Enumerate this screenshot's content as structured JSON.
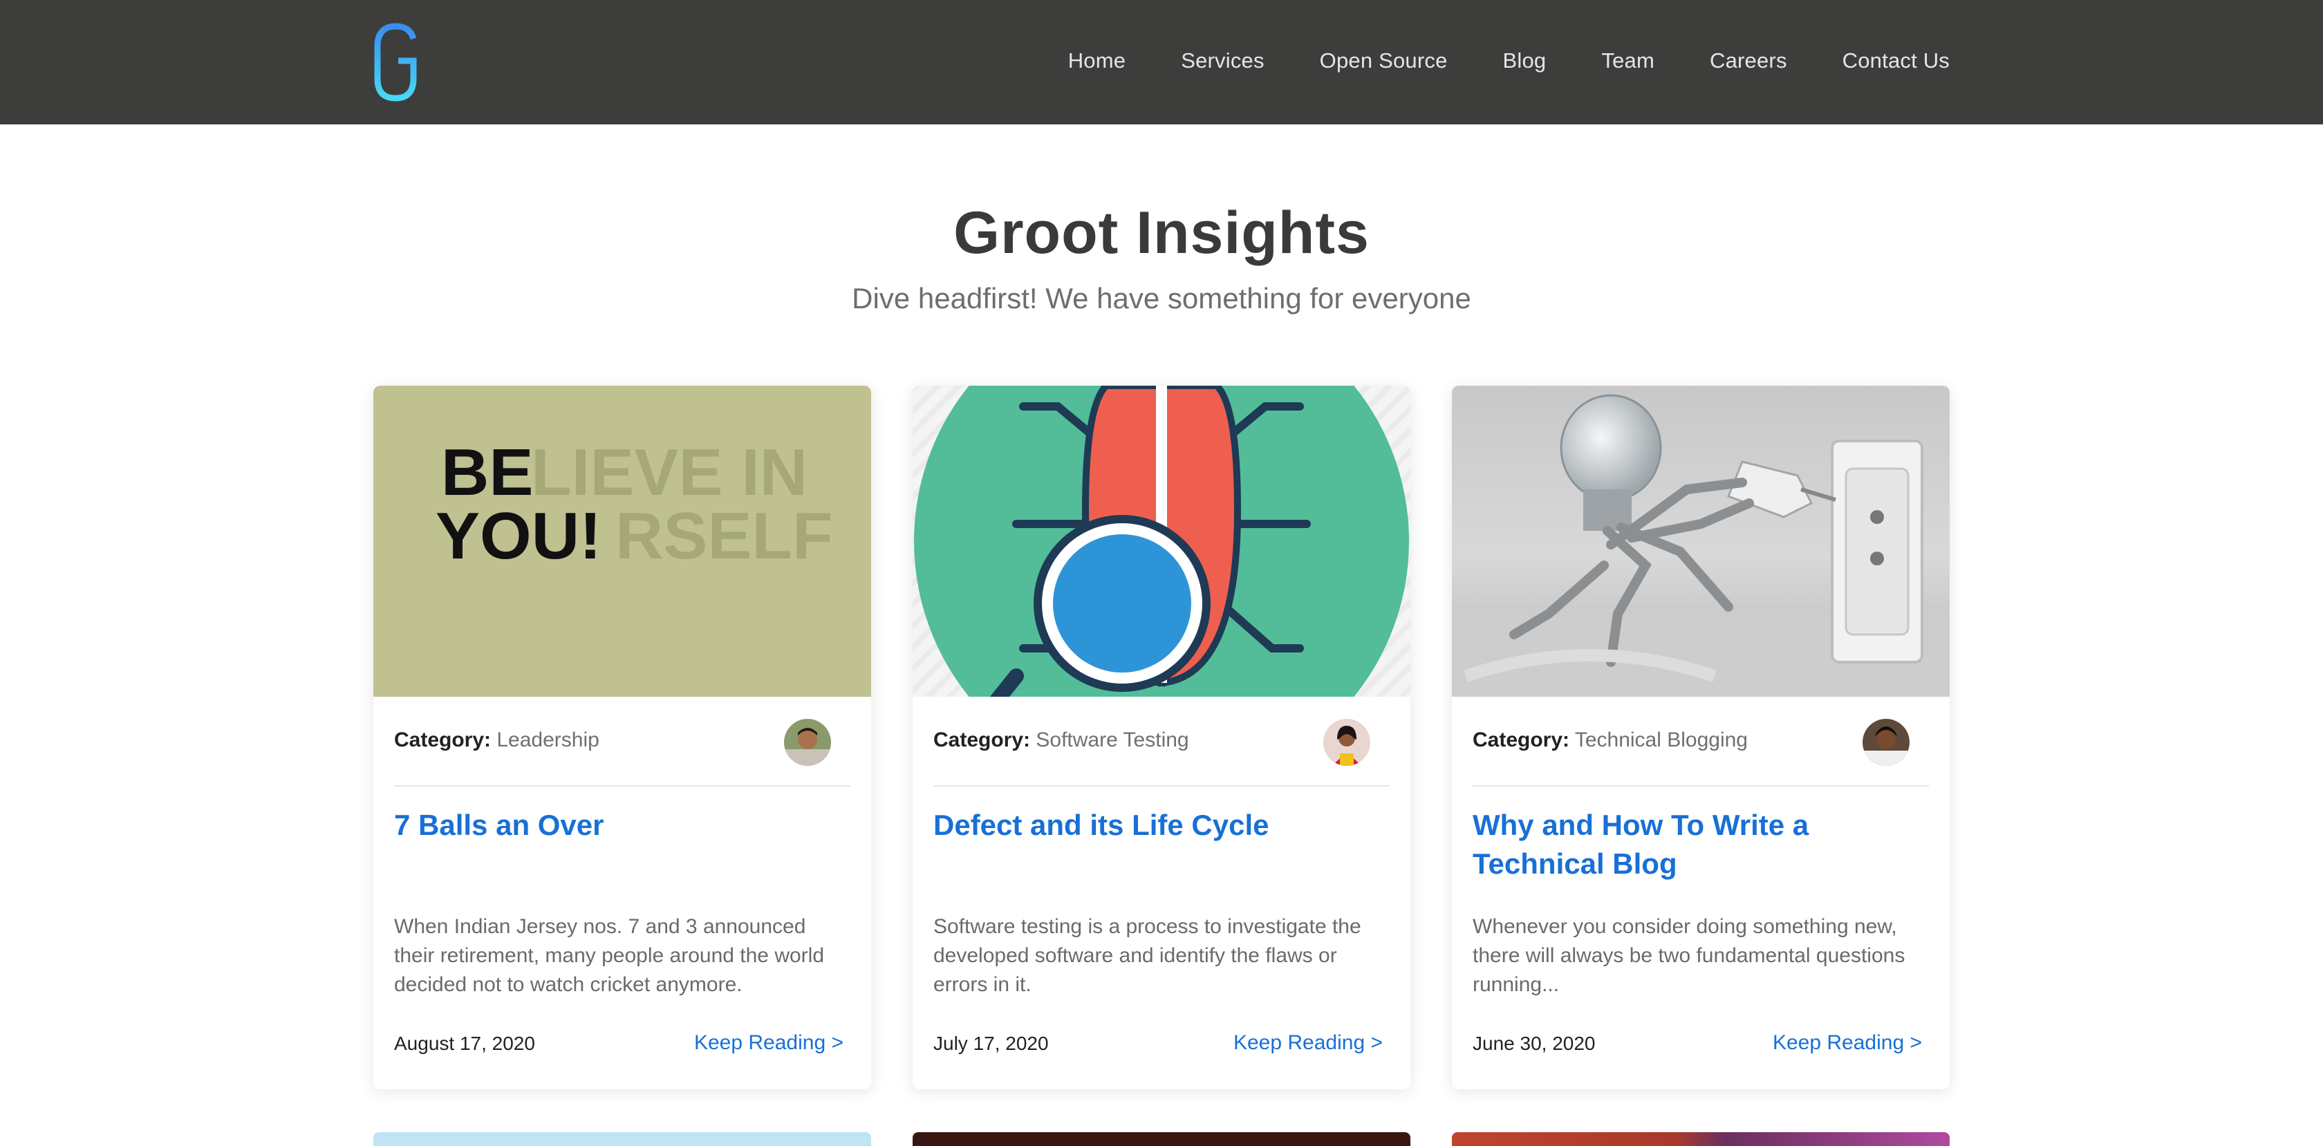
{
  "header": {
    "logo_icon": "g-logo-icon",
    "nav": [
      "Home",
      "Services",
      "Open Source",
      "Blog",
      "Team",
      "Careers",
      "Contact Us"
    ]
  },
  "hero": {
    "title": "Groot Insights",
    "subtitle": "Dive headfirst! We have something for everyone"
  },
  "cards": [
    {
      "category_label": "Category:",
      "category": "Leadership",
      "title": "7 Balls an Over",
      "excerpt": "When Indian Jersey nos. 7 and 3 announced their retirement, many people around the world decided not to watch cricket anymore.",
      "date": "August 17, 2020",
      "cta": "Keep Reading >",
      "image_text_dark": [
        "BE",
        "YOU!"
      ],
      "image_text_faded": [
        "LIEVE IN",
        "RSELF"
      ]
    },
    {
      "category_label": "Category:",
      "category": "Software Testing",
      "title": "Defect and its Life Cycle",
      "excerpt": "Software testing is a process to investigate the developed software and identify the flaws or errors in it.",
      "date": "July 17, 2020",
      "cta": "Keep Reading >"
    },
    {
      "category_label": "Category:",
      "category": "Technical Blogging",
      "title": "Why and How To Write a Technical Blog",
      "excerpt": "Whenever you consider doing something new, there will always be two fundamental questions running...",
      "date": "June 30, 2020",
      "cta": "Keep Reading >"
    }
  ],
  "colors": {
    "header_bg": "#3d3d3c",
    "accent": "#1870d5",
    "card1_bg": "#bfc191",
    "card2_green": "#52bd98",
    "card2_red": "#ee5f4f",
    "card2_blue": "#2e94d8"
  }
}
